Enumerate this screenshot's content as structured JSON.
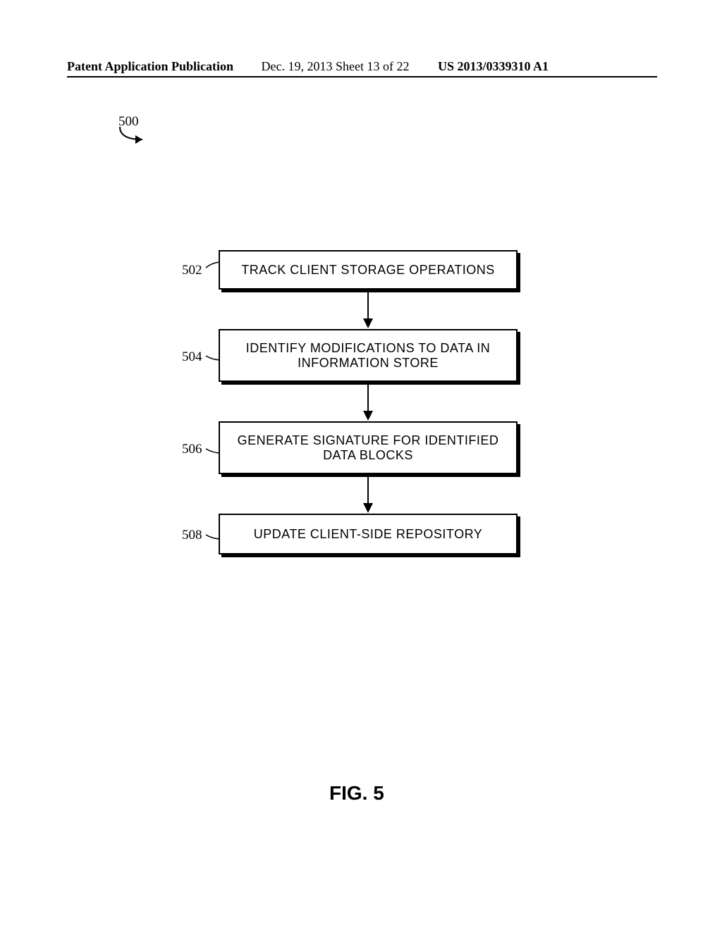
{
  "header": {
    "publication": "Patent Application Publication",
    "date_sheet": "Dec. 19, 2013  Sheet 13 of 22",
    "pub_number": "US 2013/0339310 A1"
  },
  "figure": {
    "ref_number": "500",
    "title": "FIG. 5",
    "steps": [
      {
        "num": "502",
        "text": "TRACK CLIENT STORAGE  OPERATIONS"
      },
      {
        "num": "504",
        "text": "IDENTIFY MODIFICATIONS TO DATA IN INFORMATION STORE"
      },
      {
        "num": "506",
        "text": "GENERATE SIGNATURE FOR IDENTIFIED DATA BLOCKS"
      },
      {
        "num": "508",
        "text": "UPDATE CLIENT-SIDE REPOSITORY"
      }
    ]
  }
}
